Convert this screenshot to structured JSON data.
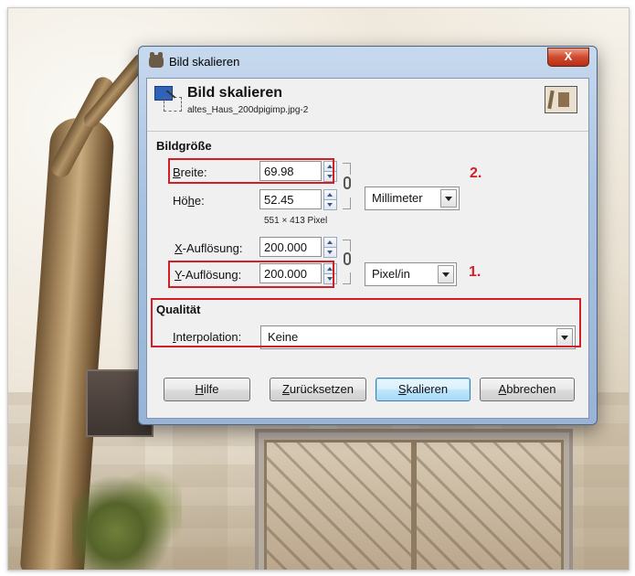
{
  "window": {
    "title": "Bild skalieren",
    "close_label": "X"
  },
  "header": {
    "title": "Bild skalieren",
    "subtitle": "altes_Haus_200dpigimp.jpg-2"
  },
  "image_size": {
    "section_label": "Bildgröße",
    "width_label_pre": "",
    "width_label_ul": "B",
    "width_label_post": "reite:",
    "width_value": "69.98",
    "height_label_pre": "Hö",
    "height_label_ul": "h",
    "height_label_post": "e:",
    "height_value": "52.45",
    "pixel_info": "551 × 413 Pixel",
    "unit": "Millimeter",
    "xres_label_pre": "",
    "xres_label_ul": "X",
    "xres_label_post": "-Auflösung:",
    "xres_value": "200.000",
    "yres_label_pre": "",
    "yres_label_ul": "Y",
    "yres_label_post": "-Auflösung:",
    "yres_value": "200.000",
    "res_unit": "Pixel/in"
  },
  "quality": {
    "section_label": "Qualität",
    "interp_label_pre": "",
    "interp_label_ul": "I",
    "interp_label_post": "nterpolation:",
    "interp_value": "Keine"
  },
  "buttons": {
    "help_ul": "H",
    "help_rest": "ilfe",
    "reset_ul": "Z",
    "reset_rest": "urücksetzen",
    "scale_ul": "S",
    "scale_rest": "kalieren",
    "cancel_ul": "A",
    "cancel_rest": "bbrechen"
  },
  "annotations": {
    "one": "1.",
    "two": "2."
  },
  "colors": {
    "annotation_red": "#d21f26",
    "default_button_blue": "#3c7fb1"
  },
  "icons": [
    "gimp-wilber-icon",
    "scale-image-icon",
    "image-thumbnail-icon",
    "chain-link-icon",
    "spin-up-icon",
    "spin-down-icon",
    "dropdown-arrow-icon"
  ]
}
